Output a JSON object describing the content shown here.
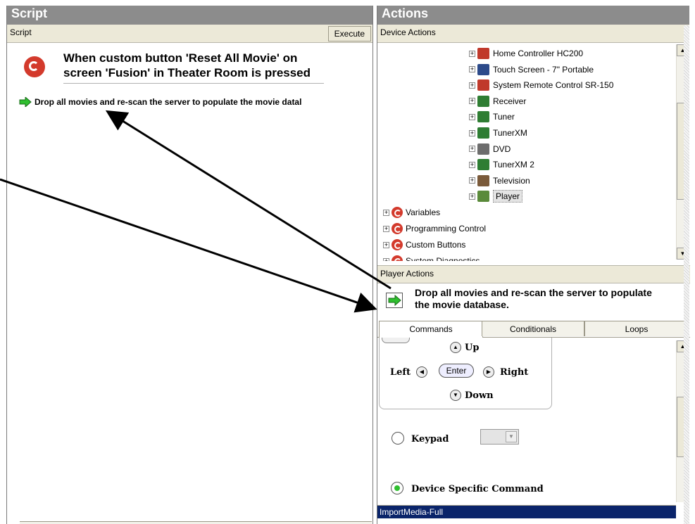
{
  "left": {
    "title": "Script",
    "header_label": "Script",
    "execute_label": "Execute",
    "trigger_line1": "When custom button 'Reset All Movie' on",
    "trigger_line2": "screen 'Fusion' in Theater Room is pressed",
    "step_text": "Drop all movies and re-scan the server to populate the movie datal"
  },
  "right": {
    "title": "Actions",
    "device_actions_label": "Device Actions",
    "tree": {
      "devices": [
        {
          "label": "Home Controller HC200",
          "icon": "remote-icon"
        },
        {
          "label": "Touch Screen - 7\" Portable",
          "icon": "touchscreen-icon"
        },
        {
          "label": "System Remote Control SR-150",
          "icon": "remote-icon"
        },
        {
          "label": "Receiver",
          "icon": "receiver-icon"
        },
        {
          "label": "Tuner",
          "icon": "tuner-icon"
        },
        {
          "label": "TunerXM",
          "icon": "tuner-icon"
        },
        {
          "label": "DVD",
          "icon": "dvd-icon"
        },
        {
          "label": "TunerXM 2",
          "icon": "tuner-icon"
        },
        {
          "label": "Television",
          "icon": "television-icon"
        },
        {
          "label": "Player",
          "icon": "player-icon"
        }
      ],
      "categories": [
        {
          "label": "Variables"
        },
        {
          "label": "Programming Control"
        },
        {
          "label": "Custom Buttons"
        },
        {
          "label": "System Diagnostics"
        }
      ]
    },
    "player_actions_label": "Player Actions",
    "player_action_line1": "Drop all movies and re-scan the server to populate",
    "player_action_line2": "the movie database.",
    "tabs": [
      {
        "label": "Commands"
      },
      {
        "label": "Conditionals"
      },
      {
        "label": "Loops"
      }
    ],
    "nav": {
      "up": "Up",
      "left": "Left",
      "enter": "Enter",
      "right": "Right",
      "down": "Down"
    },
    "keypad_label": "Keypad",
    "device_specific_label": "Device Specific Command",
    "selected_command": "ImportMedia-Full"
  },
  "colors": {
    "title_bar": "#8c8c8c",
    "selection": "#0a246a",
    "accent_red": "#d33a2c",
    "accent_green": "#2fbf2f"
  }
}
